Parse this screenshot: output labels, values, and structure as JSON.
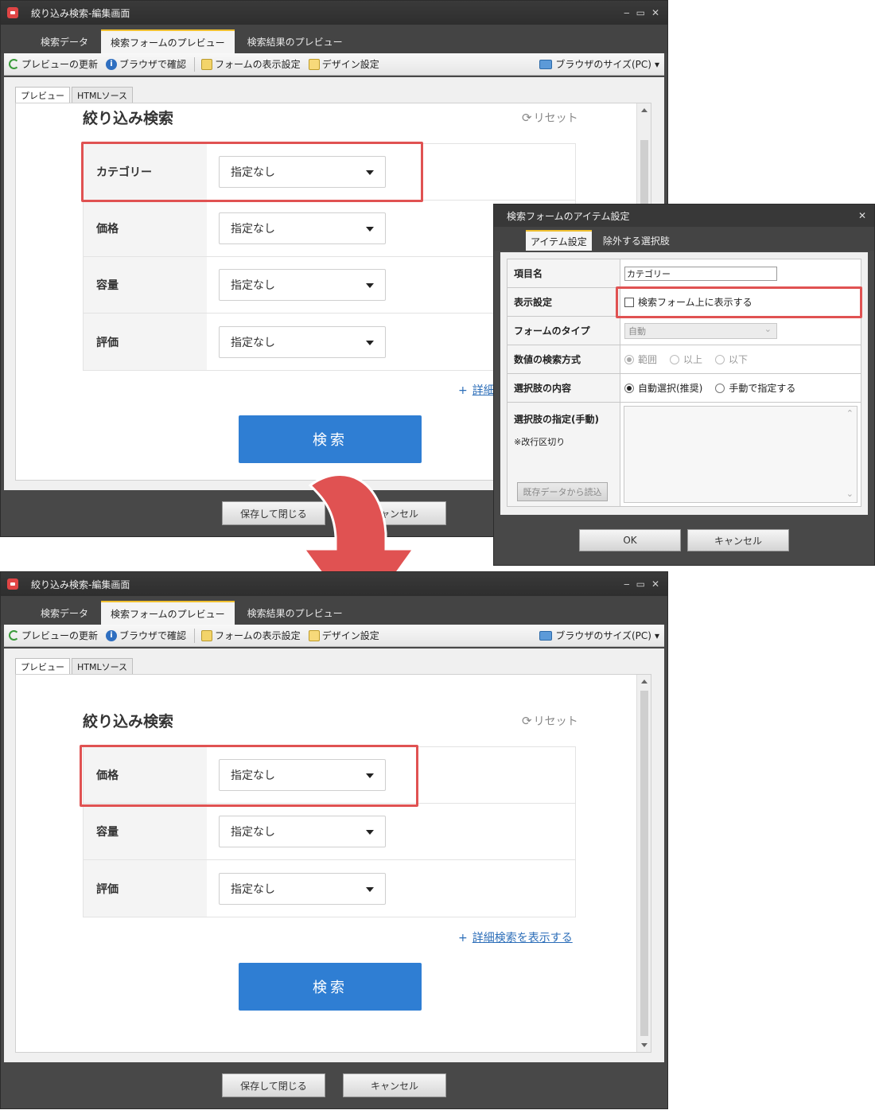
{
  "window": {
    "title": "絞り込み検索-編集画面",
    "tabs": [
      "検索データ",
      "検索フォームのプレビュー",
      "検索結果のプレビュー"
    ],
    "toolbar": {
      "refresh": "プレビューの更新",
      "browser_check": "ブラウザで確認",
      "form_display": "フォームの表示設定",
      "design": "デザイン設定",
      "browser_size": "ブラウザのサイズ(PC)"
    },
    "subtabs": [
      "プレビュー",
      "HTMLソース"
    ],
    "footer": {
      "save_close": "保存して閉じる",
      "cancel": "キャンセル"
    }
  },
  "preview_top": {
    "title": "絞り込み検索",
    "reset": "リセット",
    "rows": [
      {
        "label": "カテゴリー",
        "value": "指定なし"
      },
      {
        "label": "価格",
        "value": "指定なし"
      },
      {
        "label": "容量",
        "value": "指定なし"
      },
      {
        "label": "評価",
        "value": "指定なし"
      }
    ],
    "detail_link": "詳細",
    "search_button": "検索"
  },
  "preview_bottom": {
    "title": "絞り込み検索",
    "reset": "リセット",
    "rows": [
      {
        "label": "価格",
        "value": "指定なし"
      },
      {
        "label": "容量",
        "value": "指定なし"
      },
      {
        "label": "評価",
        "value": "指定なし"
      }
    ],
    "detail_link": "詳細検索を表示する",
    "search_button": "検索"
  },
  "dialog": {
    "title": "検索フォームのアイテム設定",
    "tabs": [
      "アイテム設定",
      "除外する選択肢"
    ],
    "fields": {
      "item_name_label": "項目名",
      "item_name_value": "カテゴリー",
      "display_label": "表示設定",
      "display_checkbox": "検索フォーム上に表示する",
      "form_type_label": "フォームのタイプ",
      "form_type_value": "自動",
      "numeric_label": "数値の検索方式",
      "numeric_options": [
        "範囲",
        "以上",
        "以下"
      ],
      "choices_label": "選択肢の内容",
      "choices_options": [
        "自動選択(推奨)",
        "手動で指定する"
      ],
      "manual_label": "選択肢の指定(手動)",
      "manual_note": "※改行区切り",
      "load_button": "既存データから読込"
    },
    "ok": "OK",
    "cancel": "キャンセル"
  },
  "colors": {
    "accent_red": "#e05252",
    "search_blue": "#2f7ed3",
    "window_dark": "#484848"
  }
}
